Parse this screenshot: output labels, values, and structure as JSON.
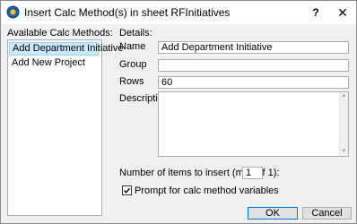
{
  "window": {
    "title": "Insert Calc Method(s) in sheet RFInitiatives",
    "help_label": "?",
    "close_label": "✕"
  },
  "left": {
    "heading": "Available Calc Methods:",
    "items": [
      {
        "label": "Add Department Initiative",
        "selected": true
      },
      {
        "label": "Add New Project",
        "selected": false
      }
    ]
  },
  "details": {
    "heading": "Details:",
    "name_label": "Name",
    "name_value": "Add Department Initiative",
    "group_label": "Group",
    "group_value": "",
    "rows_label": "Rows",
    "rows_value": "60",
    "description_label": "Description",
    "description_value": ""
  },
  "insert": {
    "count_label": "Number of items to insert (max of 1):",
    "count_value": "1",
    "prompt_label": "Prompt for calc method variables",
    "prompt_checked": true
  },
  "buttons": {
    "ok_label": "OK",
    "cancel_label": "Cancel"
  },
  "icons": [
    "app-icon",
    "help-icon",
    "close-icon",
    "checkmark-icon",
    "scroll-up-arrow-icon",
    "scroll-down-arrow-icon"
  ],
  "colors": {
    "selection_bg": "#cce8ff",
    "selection_border": "#99d1ff",
    "default_button_border": "#0078d7",
    "dialog_bg": "#f0f0f0"
  }
}
